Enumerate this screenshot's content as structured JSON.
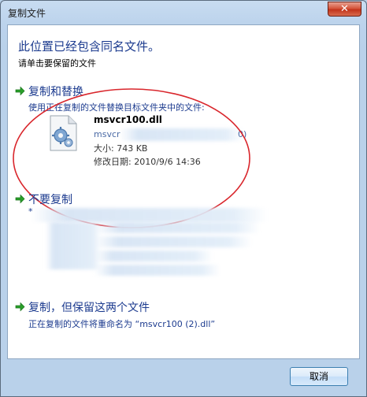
{
  "window": {
    "title": "复制文件"
  },
  "heading": "此位置已经包含同名文件。",
  "subheading": "请单击要保留的文件",
  "options": [
    {
      "title": "复制和替换",
      "desc": "使用正在复制的文件替换目标文件夹中的文件:"
    },
    {
      "title": "不要复制",
      "desc": "*"
    },
    {
      "title": "复制，但保留这两个文件",
      "desc": "正在复制的文件将重命名为 “msvcr100 (2).dll”"
    }
  ],
  "file": {
    "name": "msvcr100.dll",
    "path_visible": "msvcr",
    "path_tail": "0)",
    "size_label": "大小: 743 KB",
    "date_label": "修改日期: 2010/9/6 14:36"
  },
  "cancel_label": "取消",
  "colors": {
    "link": "#1c3b8f",
    "highlight": "#d9262c",
    "arrow": "#2aa02a"
  },
  "icons": {
    "close": "close-icon",
    "file": "dll-file-gear-icon",
    "arrow": "green-arrow-icon"
  }
}
